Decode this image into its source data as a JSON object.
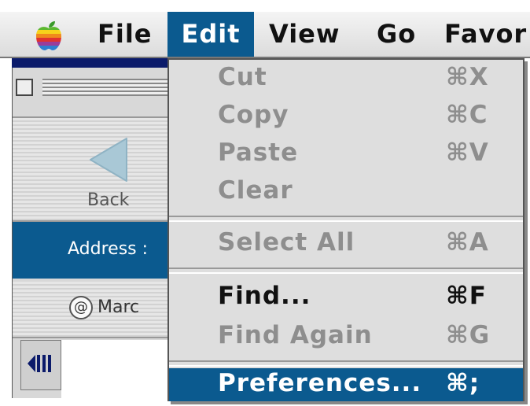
{
  "menubar": {
    "apple_icon": "apple-logo-icon",
    "items": [
      {
        "label": "File"
      },
      {
        "label": "Edit"
      },
      {
        "label": "View"
      },
      {
        "label": "Go"
      },
      {
        "label": "Favor"
      }
    ]
  },
  "window": {
    "back_label": "Back",
    "address_label": "Address :",
    "favorite_label": "Marc",
    "colors": {
      "selection": "#0b5a8f"
    }
  },
  "edit_menu": {
    "items": [
      {
        "label": "Cut",
        "shortcut": "⌘X",
        "enabled": false
      },
      {
        "label": "Copy",
        "shortcut": "⌘C",
        "enabled": false
      },
      {
        "label": "Paste",
        "shortcut": "⌘V",
        "enabled": false
      },
      {
        "label": "Clear",
        "shortcut": "",
        "enabled": false
      },
      {
        "label": "Select All",
        "shortcut": "⌘A",
        "enabled": false
      },
      {
        "label": "Find...",
        "shortcut": "⌘F",
        "enabled": true
      },
      {
        "label": "Find Again",
        "shortcut": "⌘G",
        "enabled": false
      },
      {
        "label": "Preferences...",
        "shortcut": "⌘;",
        "enabled": true,
        "highlighted": true
      }
    ]
  }
}
